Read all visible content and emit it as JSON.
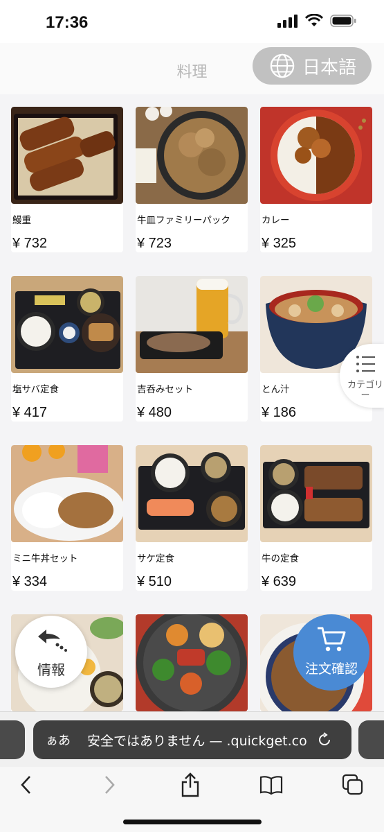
{
  "status_bar": {
    "time": "17:36"
  },
  "header": {
    "title": "料理",
    "language_button": "日本語"
  },
  "menu": {
    "items": [
      {
        "name": "鰻重",
        "price": "¥ 732"
      },
      {
        "name": "牛皿ファミリーパック",
        "price": "¥ 723"
      },
      {
        "name": "カレー",
        "price": "¥ 325"
      },
      {
        "name": "塩サバ定食",
        "price": "¥ 417"
      },
      {
        "name": "吉呑みセット",
        "price": "¥ 480"
      },
      {
        "name": "とん汁",
        "price": "¥ 186"
      },
      {
        "name": "ミニ牛丼セット",
        "price": "¥ 334"
      },
      {
        "name": "サケ定食",
        "price": "¥ 510"
      },
      {
        "name": "牛の定食",
        "price": "¥ 639"
      },
      {
        "name": "",
        "price": ""
      },
      {
        "name": "",
        "price": ""
      },
      {
        "name": "",
        "price": ""
      }
    ]
  },
  "floating": {
    "category_label": "カテゴリー",
    "info_label": "情報",
    "order_label": "注文確認"
  },
  "browser": {
    "aa": "ぁあ",
    "url_text": "安全ではありません — .quickget.co"
  },
  "colors": {
    "order_button": "#4a8ad4",
    "language_button": "#c1c1c1"
  }
}
